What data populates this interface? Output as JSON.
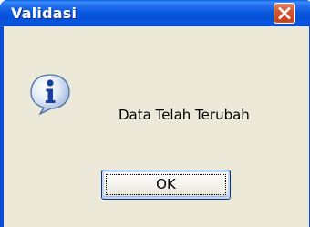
{
  "window": {
    "title": "Validasi",
    "close_icon": "close-icon"
  },
  "dialog": {
    "icon": "info-icon",
    "message": "Data Telah Terubah",
    "ok_label": "OK"
  },
  "colors": {
    "titlebar": "#0b5ae0",
    "body": "#ece9d8",
    "close_button": "#d9572d",
    "button_border": "#003c74"
  }
}
